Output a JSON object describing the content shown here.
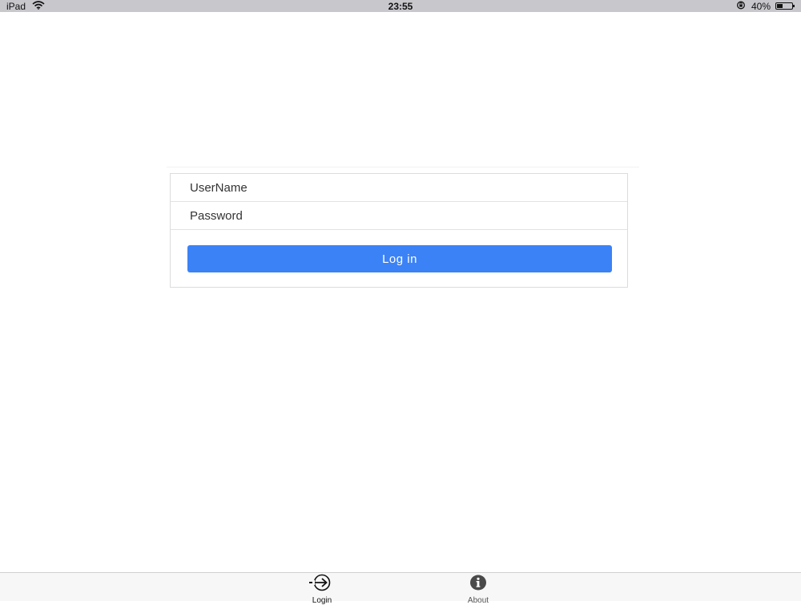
{
  "status_bar": {
    "device": "iPad",
    "time": "23:55",
    "battery": "40%",
    "battery_level": 0.4
  },
  "login_form": {
    "username_placeholder": "UserName",
    "password_placeholder": "Password",
    "login_button_label": "Log in",
    "accent_color": "#3b82f6"
  },
  "tab_bar": {
    "tabs": [
      {
        "label": "Login",
        "icon": "login-arrow-icon",
        "selected": true
      },
      {
        "label": "About",
        "icon": "info-icon",
        "selected": false
      }
    ]
  }
}
